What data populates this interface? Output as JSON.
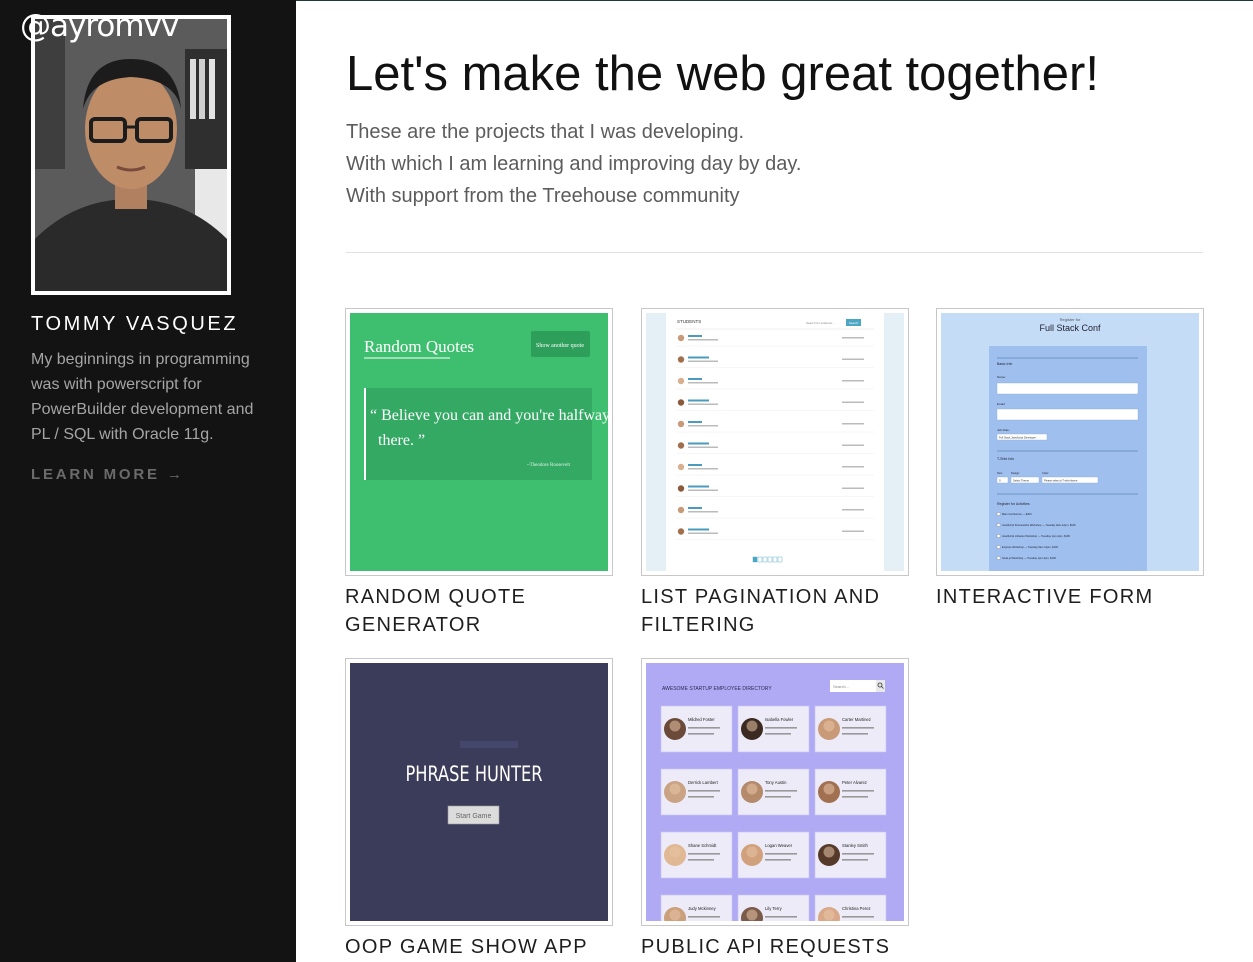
{
  "sidebar": {
    "handle": "@ayromvv",
    "name": "TOMMY VASQUEZ",
    "bio": "My beginnings in programming was with powerscript for PowerBuilder development and PL / SQL with Oracle 11g.",
    "learn_more": "LEARN MORE",
    "learn_more_arrow": "→"
  },
  "hero": {
    "title": "Let's make the web great together!",
    "lines": [
      "These are the projects that I was developing.",
      "With which I am learning and improving day by day.",
      "With support from the Treehouse community"
    ]
  },
  "projects": [
    {
      "title": "RANDOM QUOTE GENERATOR",
      "thumb": {
        "app_title": "Random Quotes",
        "button": "Show another quote",
        "quote_line1": "“ Believe you can and you're halfway",
        "quote_line2": "there. ”",
        "author": "~Theodore Roosevelt"
      }
    },
    {
      "title": "LIST PAGINATION AND FILTERING",
      "thumb": {
        "heading": "STUDENTS",
        "search_placeholder": "Search for students...",
        "search_button": "Search"
      }
    },
    {
      "title": "INTERACTIVE FORM",
      "thumb": {
        "register_for": "Register for",
        "conf_title": "Full Stack Conf",
        "basic_info": "Basic Info",
        "name_label": "Name:",
        "email_label": "Email:",
        "job_role_label": "Job Role:",
        "job_role_value": "Full Stack JavaScript Developer",
        "tshirt_info": "T-Shirt Info",
        "size_label": "Size:",
        "size_value": "S",
        "design_label": "Design:",
        "design_value": "Select Theme",
        "color_label": "Color:",
        "color_value": "Please select a T-shirt theme",
        "activities_title": "Register for Activities",
        "activities": [
          "Main Conference — $200",
          "JavaScript Frameworks Workshop — Tuesday 9am-12pm, $100",
          "JavaScript Libraries Workshop — Tuesday 1pm-4pm, $100",
          "Express Workshop — Tuesday 9am-12pm, $100",
          "Node.js Workshop — Tuesday 1pm-4pm, $100"
        ]
      }
    },
    {
      "title": "OOP GAME SHOW APP",
      "thumb": {
        "game_title": "PHRASE HUNTER",
        "start_button": "Start Game"
      }
    },
    {
      "title": "PUBLIC API REQUESTS",
      "thumb": {
        "header": "AWESOME STARTUP EMPLOYEE DIRECTORY",
        "search_placeholder": "Search...",
        "employees": [
          "Mildred Foster",
          "Isabella Fowler",
          "Carter Martinez",
          "Derrick Lambert",
          "Tony Austin",
          "Peter Alvarez",
          "Shane Schmidt",
          "Logan Weaver",
          "Stanley Smith",
          "Judy Mckinney",
          "Lily Terry",
          "Christina Perez"
        ]
      }
    }
  ],
  "colors": {
    "sidebar_bg": "#131313",
    "quote_green": "#3dbf6f",
    "pagination_blue": "#4ba6c3",
    "form_blue": "#c5dcf6",
    "game_navy": "#3b3c5a",
    "directory_purple": "#b0aaf4"
  }
}
